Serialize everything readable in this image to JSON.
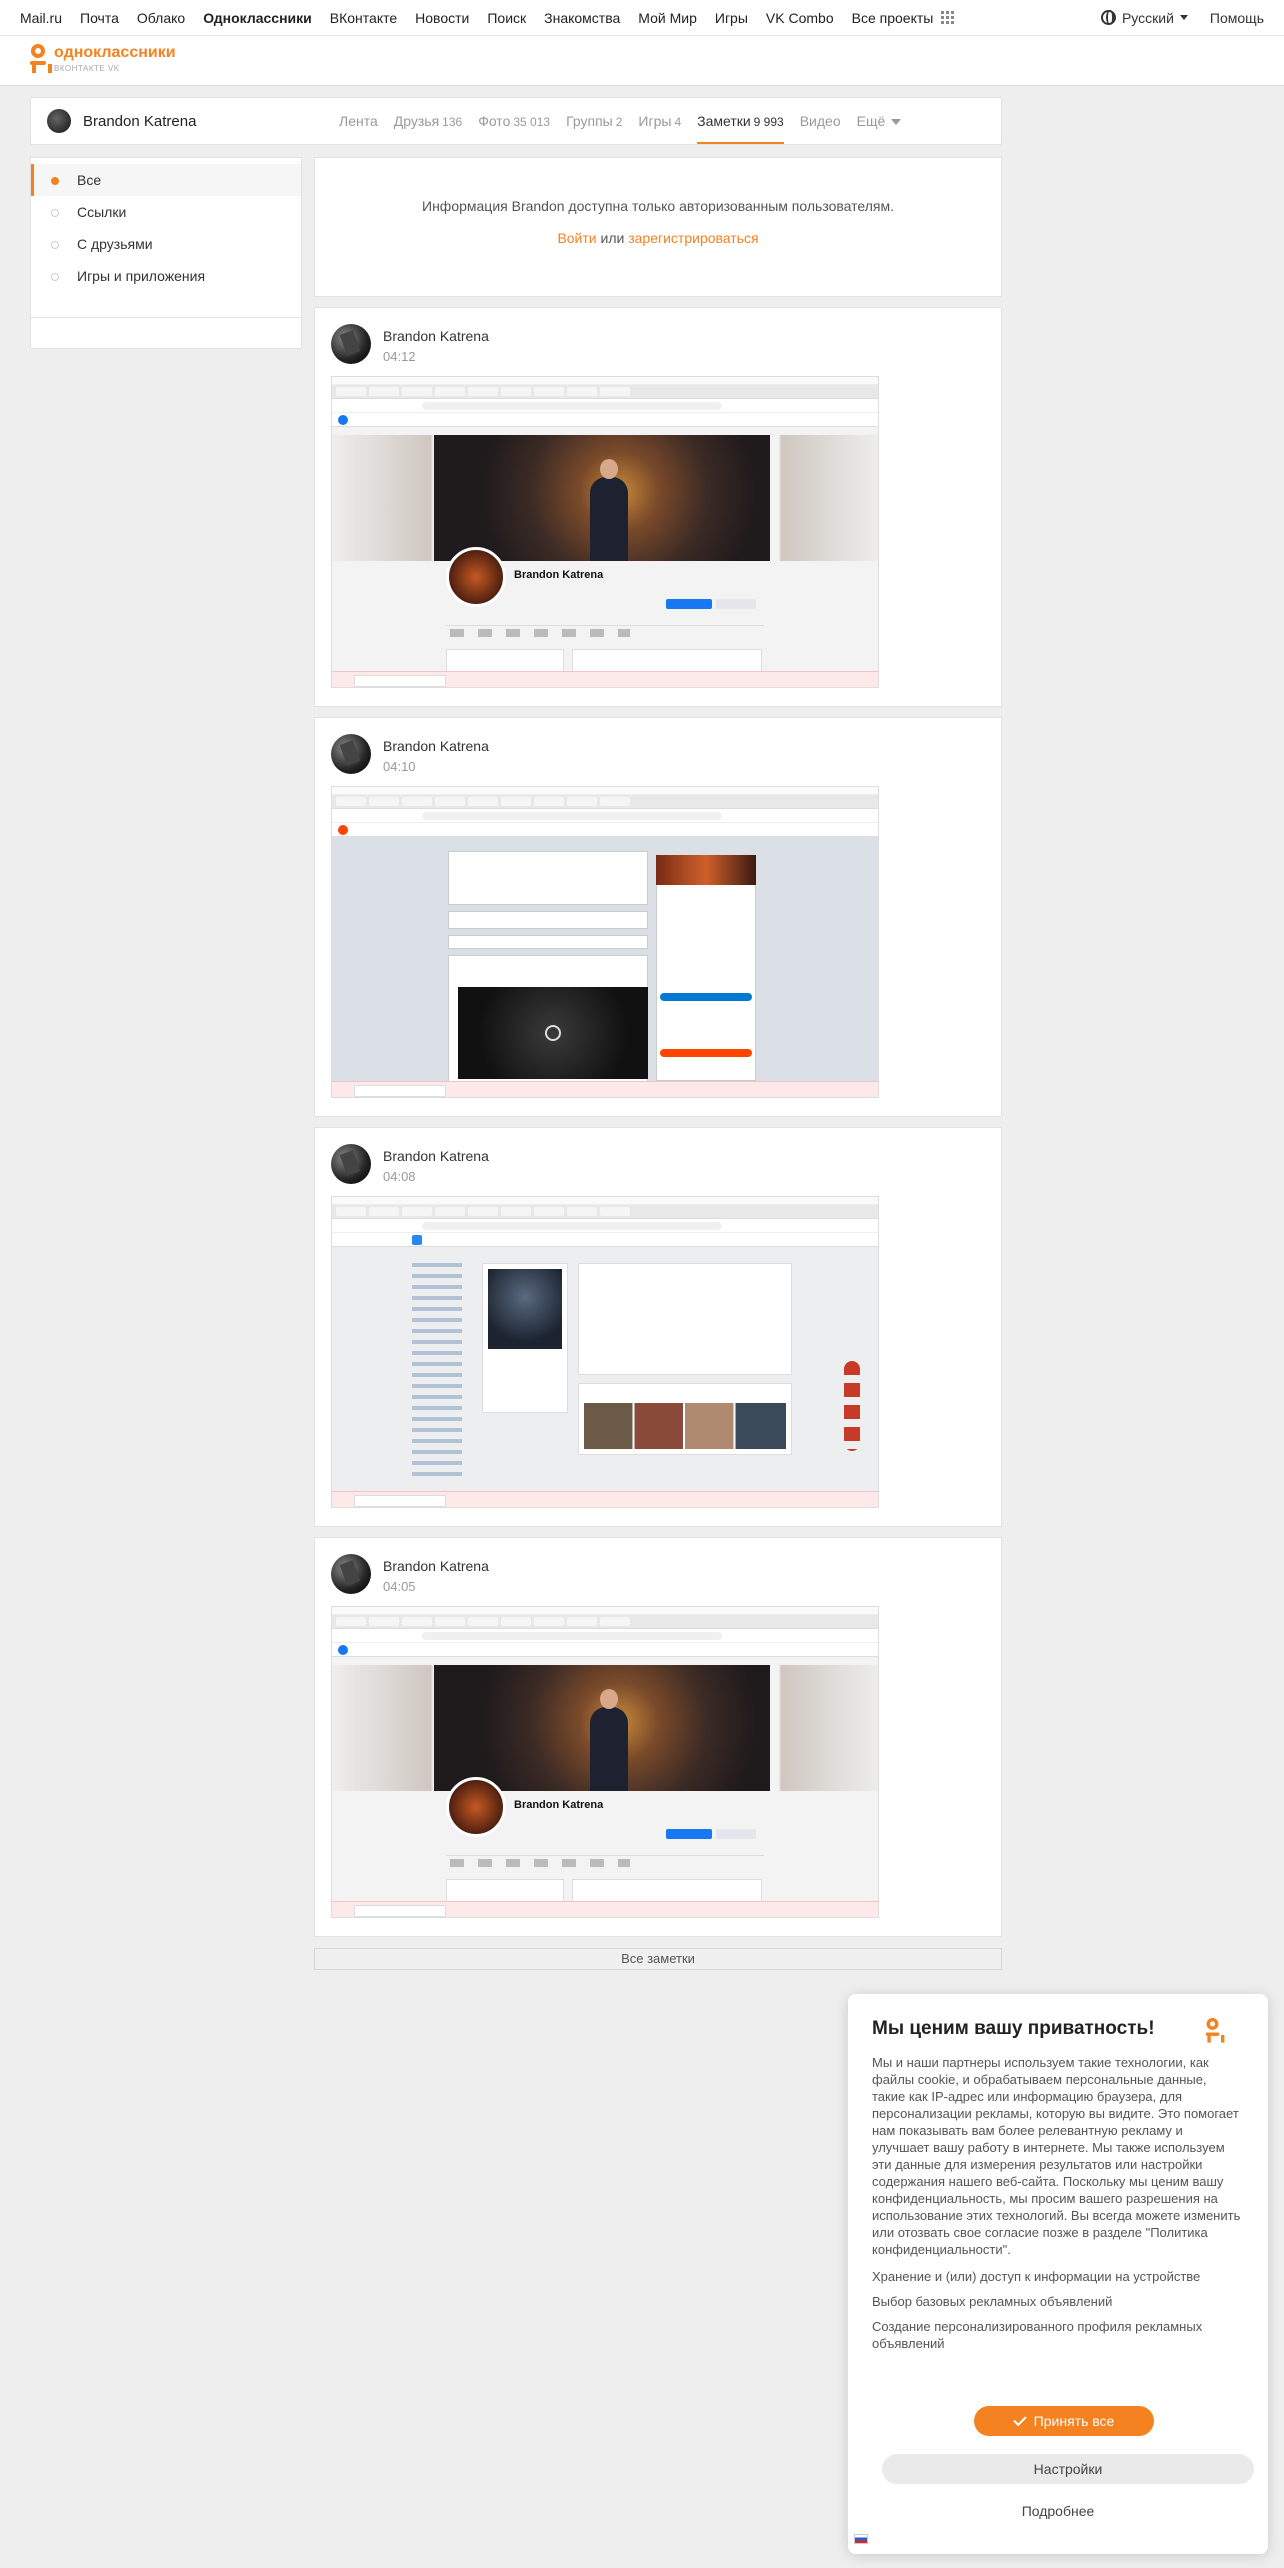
{
  "topbar": {
    "links": [
      "Mail.ru",
      "Почта",
      "Облако",
      "Одноклассники",
      "ВКонтакте",
      "Новости",
      "Поиск",
      "Знакомства",
      "Мой Мир",
      "Игры",
      "VK Combo",
      "Все проекты"
    ],
    "active_link": "Одноклассники",
    "language": "Русский",
    "help": "Помощь"
  },
  "logo": {
    "text": "одноклассники",
    "subtext": "ВКОНТАКТЕ VK"
  },
  "profile": {
    "name": "Brandon Katrena",
    "tabs": [
      {
        "label": "Лента",
        "count": ""
      },
      {
        "label": "Друзья",
        "count": "136"
      },
      {
        "label": "Фото",
        "count": "35 013"
      },
      {
        "label": "Группы",
        "count": "2"
      },
      {
        "label": "Игры",
        "count": "4"
      },
      {
        "label": "Заметки",
        "count": "9 993"
      },
      {
        "label": "Видео",
        "count": ""
      },
      {
        "label": "Ещё",
        "count": ""
      }
    ],
    "active_tab": "Заметки"
  },
  "left_menu": {
    "items": [
      "Все",
      "Ссылки",
      "С друзьями",
      "Игры и приложения"
    ],
    "active": "Все"
  },
  "auth": {
    "message": "Информация Brandon доступна только авторизованным пользователям.",
    "login": "Войти",
    "or": "или",
    "register": "зарегистрироваться"
  },
  "posts": [
    {
      "author": "Brandon Katrena",
      "time": "04:12",
      "screenshot_app": "facebook",
      "profile_name": "Brandon Katrena"
    },
    {
      "author": "Brandon Katrena",
      "time": "04:10",
      "screenshot_app": "reddit"
    },
    {
      "author": "Brandon Katrena",
      "time": "04:08",
      "screenshot_app": "vk"
    },
    {
      "author": "Brandon Katrena",
      "time": "04:05",
      "screenshot_app": "facebook",
      "profile_name": "Brandon Katrena"
    }
  ],
  "all_notes": "Все заметки",
  "cookie": {
    "title": "Мы ценим вашу приватность!",
    "body": "Мы и наши партнеры используем такие технологии, как файлы cookie, и обрабатываем персональные данные, такие как IP-адрес или информацию браузера, для персонализации рекламы, которую вы видите. Это помогает нам показывать вам более релевантную рекламу и улучшает вашу работу в интернете. Мы также используем эти данные для измерения результатов или настройки содержания нашего веб-сайта. Поскольку мы ценим вашу конфиденциальность, мы просим вашего разрешения на использование этих технологий. Вы всегда можете изменить или отозвать свое согласие позже в разделе \"Политика конфиденциальности\".",
    "purposes": [
      "Хранение и (или) доступ к информации на устройстве",
      "Выбор базовых рекламных объявлений",
      "Создание персонализированного профиля рекламных объявлений"
    ],
    "accept": "Принять все",
    "settings": "Настройки",
    "more": "Подробнее"
  },
  "colors": {
    "brand": "#f58220",
    "facebook": "#1877f2",
    "reddit": "#ff4500",
    "vk": "#2787f5"
  }
}
